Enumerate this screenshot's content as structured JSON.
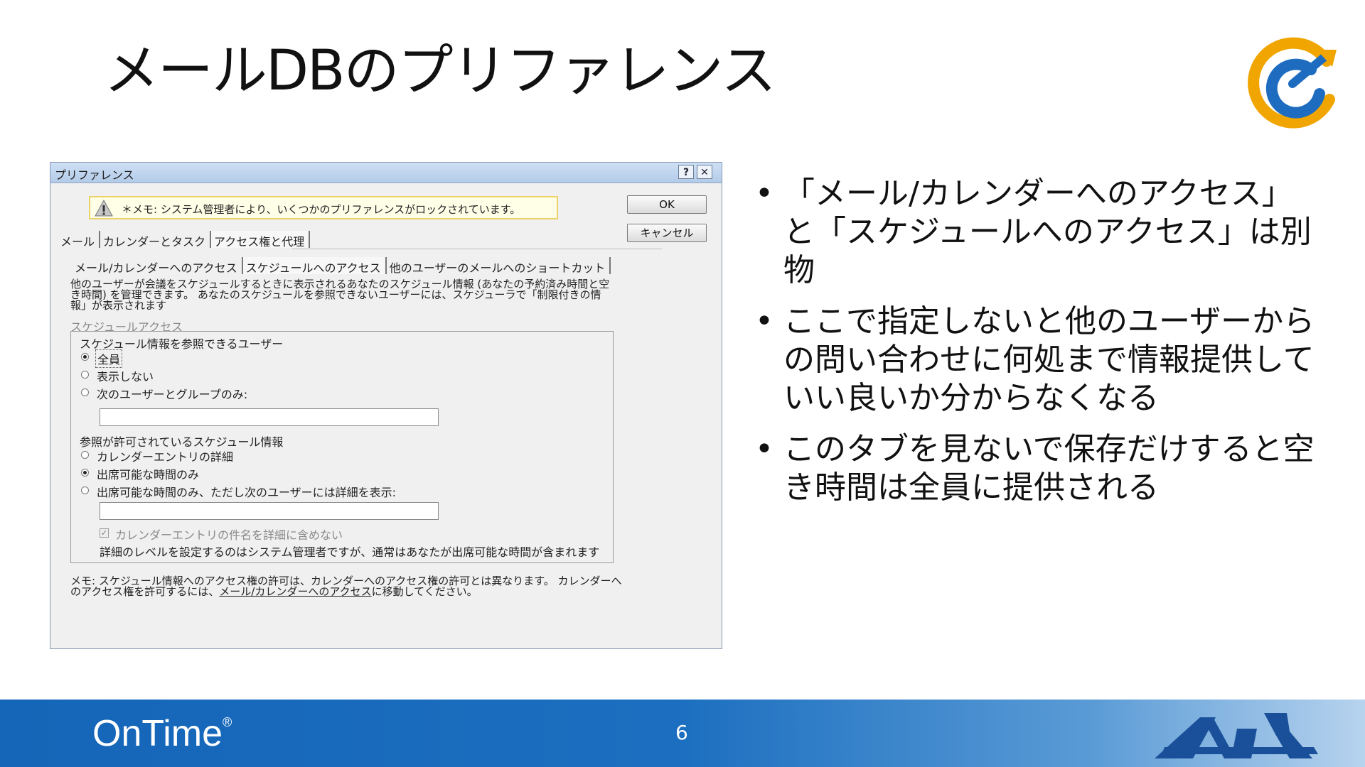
{
  "slide": {
    "title": "メールDBのプリファレンス",
    "page_number": "6",
    "bullets": [
      "「メール/カレンダーへのアクセス」と「スケジュールへのアクセス」は別物",
      "ここで指定しないと他のユーザーからの問い合わせに何処まで情報提供していい良いか分からなくなる",
      "このタブを見ないで保存だけすると空き時間は全員に提供される"
    ],
    "footer": {
      "brand": "OnTime",
      "brand_mark": "®"
    },
    "colors": {
      "footer_blue": "#1565b8",
      "logo_orange": "#f0a500",
      "logo_blue": "#1d6cc0"
    }
  },
  "dialog": {
    "title": "プリファレンス",
    "help_label": "?",
    "close_label": "✕",
    "warning": "＊メモ: システム管理者により、いくつかのプリファレンスがロックされています。",
    "ok_label": "OK",
    "cancel_label": "キャンセル",
    "tabs": [
      "メール",
      "カレンダーとタスク",
      "アクセス権と代理"
    ],
    "subtabs": [
      "メール/カレンダーへのアクセス",
      "スケジュールへのアクセス",
      "他のユーザーのメールへのショートカット"
    ],
    "description": "他のユーザーが会議をスケジュールするときに表示されるあなたのスケジュール情報 (あなたの予約済み時間と空き時間) を管理できます。 あなたのスケジュールを参照できないユーザーには、スケジューラで「制限付きの情報」が表示されます",
    "section_label": "スケジュールアクセス",
    "who_label": "スケジュール情報を参照できるユーザー",
    "who_options": [
      "全員",
      "表示しない",
      "次のユーザーとグループのみ:"
    ],
    "who_selected": "全員",
    "who_users_value": "",
    "info_label": "参照が許可されているスケジュール情報",
    "info_options": [
      "カレンダーエントリの詳細",
      "出席可能な時間のみ",
      "出席可能な時間のみ、ただし次のユーザーには詳細を表示:"
    ],
    "info_selected": "出席可能な時間のみ",
    "info_users_value": "",
    "exclude_subject_label": "カレンダーエントリの件名を詳細に含めない",
    "exclude_subject_checked": true,
    "detail_level_note": "詳細のレベルを設定するのはシステム管理者ですが、通常はあなたが出席可能な時間が含まれます",
    "bottom_note_prefix": "メモ: スケジュール情報へのアクセス権の許可は、カレンダーへのアクセス権の許可とは異なります。 カレンダーへのアクセス権を許可するには、",
    "bottom_note_link": "メール/カレンダーへのアクセス",
    "bottom_note_suffix": "に移動してください。"
  }
}
